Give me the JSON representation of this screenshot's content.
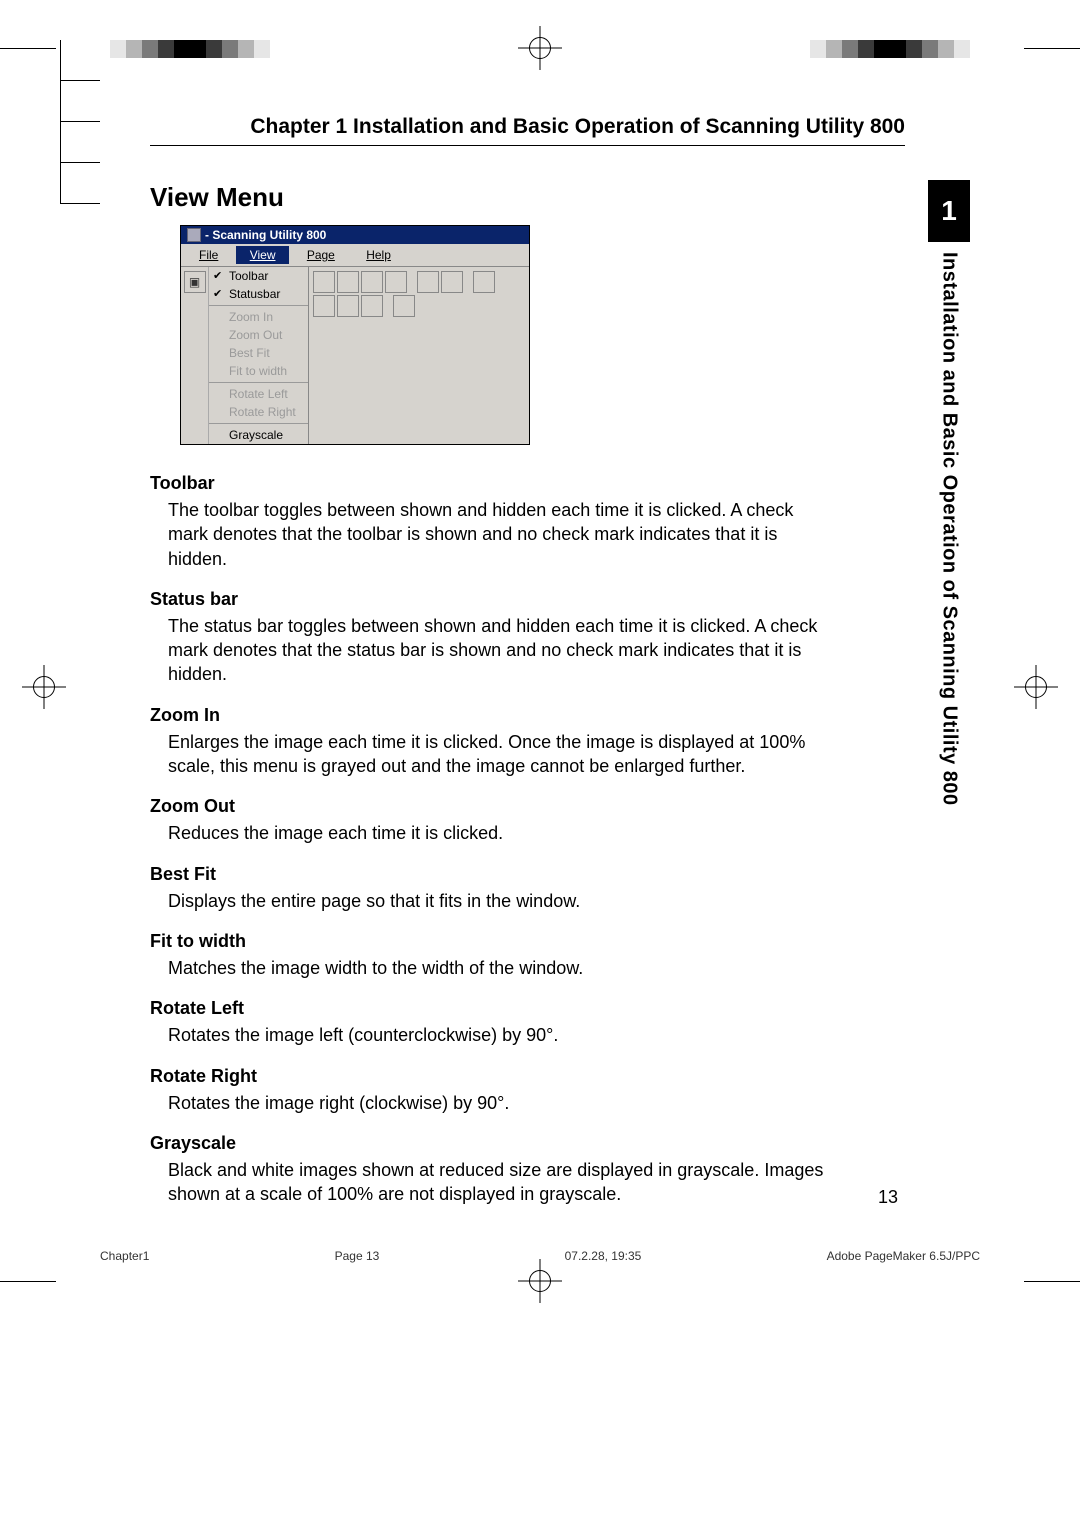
{
  "chapter_title": "Chapter 1 Installation and Basic Operation of Scanning Utility 800",
  "section_title": "View Menu",
  "sidetab": {
    "number": "1",
    "label": "Installation and Basic Operation of Scanning Utility 800"
  },
  "page_number": "13",
  "slug": {
    "left": "Chapter1",
    "center": "Page 13",
    "date": "07.2.28, 19:35",
    "app": "Adobe PageMaker 6.5J/PPC"
  },
  "screenshot": {
    "window_title": "- Scanning Utility 800",
    "menubar": {
      "file": "File",
      "view": "View",
      "page": "Page",
      "help": "Help"
    },
    "view_menu": {
      "toolbar": "Toolbar",
      "statusbar": "Statusbar",
      "zoom_in": "Zoom In",
      "zoom_out": "Zoom Out",
      "best_fit": "Best Fit",
      "fit_to_width": "Fit to width",
      "rotate_left": "Rotate Left",
      "rotate_right": "Rotate Right",
      "grayscale": "Grayscale"
    }
  },
  "defs": {
    "toolbar": {
      "term": "Toolbar",
      "desc": "The toolbar toggles between shown and hidden each time it is clicked. A check mark denotes that the toolbar is shown and no check mark indicates that it is hidden."
    },
    "statusbar": {
      "term": "Status bar",
      "desc": "The status bar toggles between shown and hidden each time it is clicked. A check mark denotes that the status bar is shown and no check mark indicates that it is hidden."
    },
    "zoom_in": {
      "term": "Zoom In",
      "desc": "Enlarges the image each time it is clicked. Once the image is displayed at 100% scale, this menu is grayed out and the image cannot be enlarged further."
    },
    "zoom_out": {
      "term": "Zoom Out",
      "desc": "Reduces the image each time it is clicked."
    },
    "best_fit": {
      "term": "Best Fit",
      "desc": "Displays the entire page so that it fits in the window."
    },
    "fit_to_width": {
      "term": "Fit to width",
      "desc": "Matches the image width to the width of the window."
    },
    "rotate_left": {
      "term": "Rotate Left",
      "desc": "Rotates the image left (counterclockwise) by 90°."
    },
    "rotate_right": {
      "term": "Rotate Right",
      "desc": "Rotates the image right (clockwise) by 90°."
    },
    "grayscale": {
      "term": "Grayscale",
      "desc": "Black and white images shown at reduced size are displayed in grayscale. Images shown at a scale of 100% are not displayed in grayscale."
    }
  }
}
